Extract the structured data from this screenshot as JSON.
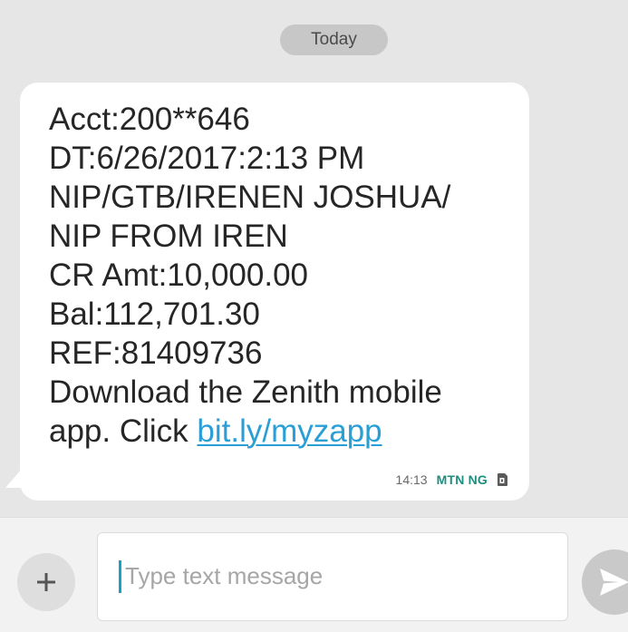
{
  "thread": {
    "date_separator": "Today"
  },
  "message": {
    "lines": [
      "Acct:200**646",
      "DT:6/26/2017:2:13 PM",
      "NIP/GTB/IRENEN JOSHUA/",
      "NIP FROM IREN",
      "CR Amt:10,000.00",
      "Bal:112,701.30",
      "REF:81409736",
      "Download the Zenith mobile"
    ],
    "last_line_prefix": "app. Click ",
    "link_text": "bit.ly/myzapp",
    "time": "14:13",
    "carrier": "MTN NG",
    "sim_icon": "sim-card-icon"
  },
  "compose": {
    "placeholder": "Type text message",
    "value": "",
    "add_icon": "plus-icon",
    "send_icon": "send-icon"
  },
  "colors": {
    "background": "#e6e6e6",
    "bubble": "#ffffff",
    "link": "#2a9fd6",
    "carrier": "#1d8f7e",
    "cursor": "#1aa0c8"
  }
}
